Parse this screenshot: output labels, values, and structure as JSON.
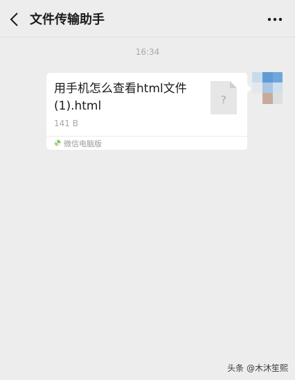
{
  "navbar": {
    "title": "文件传输助手",
    "back_icon": "chevron-left-icon",
    "more_icon": "more-dots-icon"
  },
  "chat": {
    "time": "16:34",
    "message": {
      "file_name": "用手机怎么查看html文件(1).html",
      "file_size": "141 B",
      "file_icon": "unknown-file-icon",
      "file_icon_glyph": "?",
      "source_label": "微信电脑版",
      "source_icon": "wechat-pc-icon"
    }
  },
  "watermark": "头条 @木沐笙熙",
  "colors": {
    "background": "#ededed",
    "bubble": "#ffffff",
    "title": "#1a1a1a",
    "muted": "#a8a8a8",
    "source_green": "#7bc44a"
  }
}
